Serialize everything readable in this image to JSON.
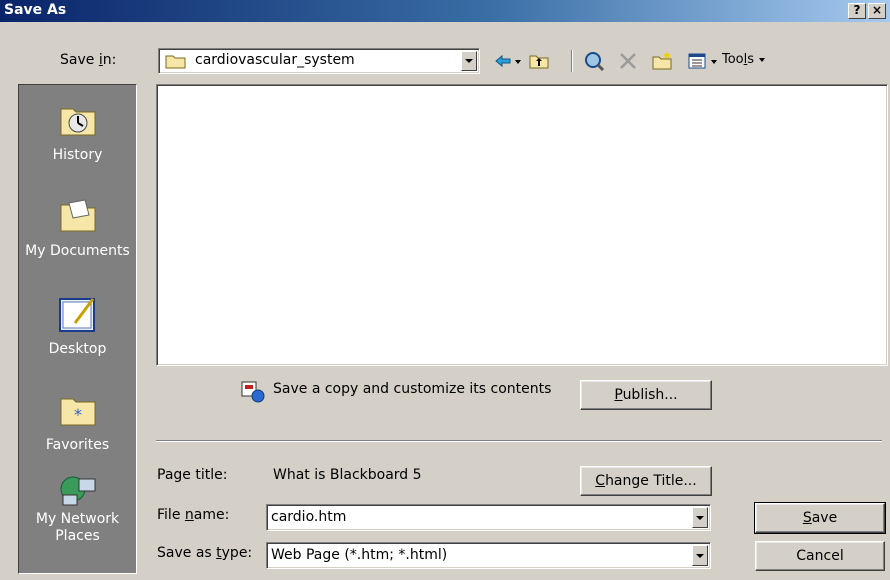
{
  "title": "Save As",
  "titlebar": {
    "help": "?",
    "close": "×"
  },
  "save_in": {
    "label_pre": "Save ",
    "label_key": "i",
    "label_post": "n:",
    "value": "cardiovascular_system"
  },
  "toolbar": {
    "icons": [
      "back-arrow-icon",
      "up-folder-icon",
      "search-web-icon",
      "delete-icon",
      "new-folder-icon",
      "views-icon"
    ],
    "tools_pre": "Too",
    "tools_key": "l",
    "tools_post": "s"
  },
  "places": [
    {
      "label": "History",
      "icon": "history-icon"
    },
    {
      "label": "My Documents",
      "icon": "my-documents-icon"
    },
    {
      "label": "Desktop",
      "icon": "desktop-icon"
    },
    {
      "label": "Favorites",
      "icon": "favorites-icon"
    },
    {
      "label": "My Network Places",
      "label_line1": "My Network",
      "label_line2": "Places",
      "icon": "network-places-icon"
    }
  ],
  "publish": {
    "description": "Save a copy and customize its contents",
    "button_key": "P",
    "button_rest": "ublish..."
  },
  "page_title": {
    "label": "Page title:",
    "value": "What is Blackboard 5",
    "button_key": "C",
    "button_rest": "hange Title..."
  },
  "file_name": {
    "label_pre": "File ",
    "label_key": "n",
    "label_post": "ame:",
    "value": "cardio.htm"
  },
  "save_as_type": {
    "label_pre": "Save as ",
    "label_key": "t",
    "label_post": "ype:",
    "value": "Web Page (*.htm; *.html)"
  },
  "buttons": {
    "save_key": "S",
    "save_rest": "ave",
    "cancel": "Cancel"
  }
}
